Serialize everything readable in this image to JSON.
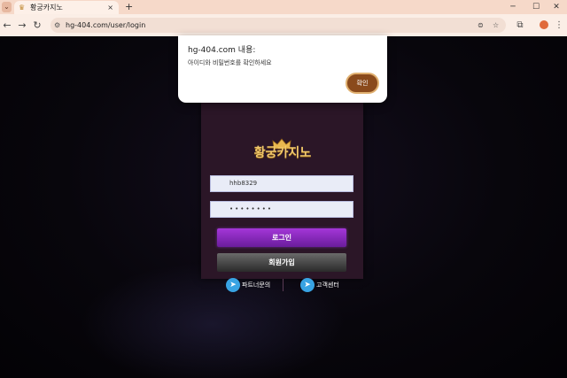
{
  "browser": {
    "tab_title": "황궁카지노",
    "tab_close": "×",
    "new_tab": "+",
    "url": "hg-404.com/user/login",
    "controls": {
      "minimize": "─",
      "maximize": "☐",
      "close": "✕"
    }
  },
  "alert": {
    "title": "hg-404.com 내용:",
    "message": "아이디와 비밀번호를 확인하세요",
    "ok_label": "확인"
  },
  "login": {
    "logo": "황궁카지노",
    "username_value": "hhb8329",
    "password_value": "••••••••",
    "login_label": "로그인",
    "signup_label": "회원가입",
    "partner_link": "파트너문의",
    "support_link": "고객센터"
  },
  "colors": {
    "accent_purple": "#8a2bc2",
    "logo_gold": "#f2c96b",
    "telegram_blue": "#38a3e3"
  }
}
